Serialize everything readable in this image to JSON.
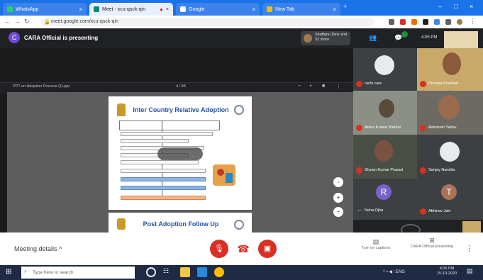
{
  "browser": {
    "tabs": [
      {
        "label": "WhatsApp",
        "active": false
      },
      {
        "label": "Meet - xcu-qsck-qin",
        "active": true
      },
      {
        "label": "Google",
        "active": false
      },
      {
        "label": "New Tab",
        "active": false
      }
    ],
    "url": "meet.google.com/xcu-qsck-qin"
  },
  "meeting": {
    "presenter_initial": "C",
    "presenting_text": "CARA Official is presenting",
    "host_chip": "Shaffanu Devi and 32 more",
    "time": "4:05 PM",
    "slidebar_title": "PPT on Adoption Process (1).ppt",
    "slidebar_page": "4 / 88"
  },
  "slide": {
    "title": "Inter Country Relative Adoption",
    "next_title": "Post Adoption Follow Up"
  },
  "participants": [
    {
      "name": "rachi care",
      "type": "emblem"
    },
    {
      "name": "Prerana Pradhan",
      "type": "photo"
    },
    {
      "name": "Ankur Kumar Parihar",
      "type": "photo"
    },
    {
      "name": "Ashutosh Yadav",
      "type": "photo"
    },
    {
      "name": "Shyam Kumar Prasad",
      "type": "photo"
    },
    {
      "name": "Sanjay Nandita",
      "type": "emblem"
    },
    {
      "name": "Neha Ojha",
      "type": "initial",
      "initial": "R"
    },
    {
      "name": "Abhinav Jain",
      "type": "initial",
      "initial": "T"
    }
  ],
  "bottom": {
    "meeting_details": "Meeting details",
    "turn_on_captions": "Turn on captions",
    "presenting_label": "CARA Official presenting"
  },
  "taskbar": {
    "search_placeholder": "Type here to search",
    "clock_time": "4:05 PM",
    "clock_date": "15-10-2020"
  },
  "colors": {
    "chrome_blue": "#1a73e8",
    "meet_dark": "#202124",
    "end_call_red": "#d93025",
    "slide_title_blue": "#2451a3"
  }
}
